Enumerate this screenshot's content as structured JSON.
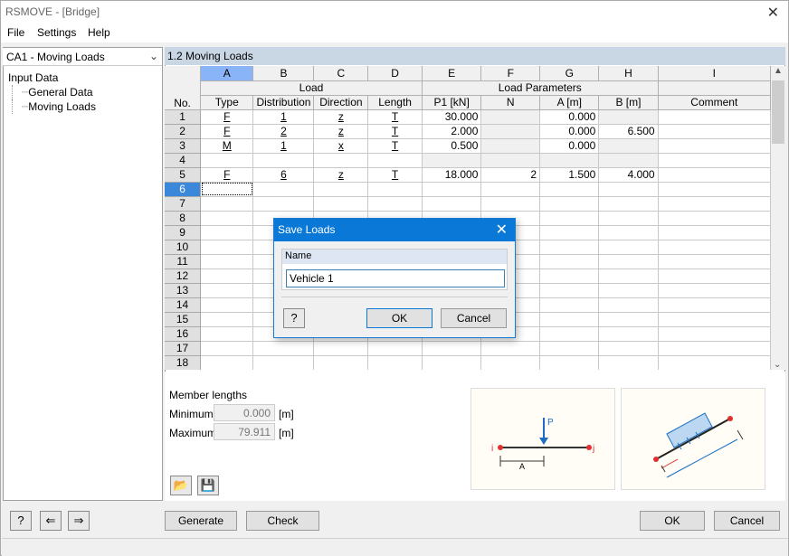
{
  "window": {
    "title": "RSMOVE - [Bridge]"
  },
  "menu": {
    "file": "File",
    "settings": "Settings",
    "help": "Help"
  },
  "case_selector": {
    "value": "CA1 - Moving Loads"
  },
  "tree": {
    "root": "Input Data",
    "items": [
      "General Data",
      "Moving Loads"
    ]
  },
  "panel": {
    "title": "1.2 Moving Loads"
  },
  "table": {
    "col_letters": [
      "A",
      "B",
      "C",
      "D",
      "E",
      "F",
      "G",
      "H",
      "I"
    ],
    "group_load": "Load",
    "group_params": "Load Parameters",
    "headers": [
      "No.",
      "Type",
      "Distribution",
      "Direction",
      "Length",
      "P1 [kN]",
      "N",
      "A [m]",
      "B [m]",
      "Comment"
    ],
    "rows": [
      {
        "no": "1",
        "type": "F",
        "dist": "1",
        "dir": "z",
        "len": "T",
        "p1": "30.000",
        "n": "",
        "a": "0.000",
        "b": "",
        "comment": ""
      },
      {
        "no": "2",
        "type": "F",
        "dist": "2",
        "dir": "z",
        "len": "T",
        "p1": "2.000",
        "n": "",
        "a": "0.000",
        "b": "6.500",
        "comment": ""
      },
      {
        "no": "3",
        "type": "M",
        "dist": "1",
        "dir": "x",
        "len": "T",
        "p1": "0.500",
        "n": "",
        "a": "0.000",
        "b": "",
        "comment": ""
      },
      {
        "no": "4",
        "type": "",
        "dist": "",
        "dir": "",
        "len": "",
        "p1": "",
        "n": "",
        "a": "",
        "b": "",
        "comment": ""
      },
      {
        "no": "5",
        "type": "F",
        "dist": "6",
        "dir": "z",
        "len": "T",
        "p1": "18.000",
        "n": "2",
        "a": "1.500",
        "b": "4.000",
        "comment": ""
      },
      {
        "no": "6",
        "type": "",
        "dist": "",
        "dir": "",
        "len": "",
        "p1": "",
        "n": "",
        "a": "",
        "b": "",
        "comment": ""
      },
      {
        "no": "7",
        "type": "",
        "dist": "",
        "dir": "",
        "len": "",
        "p1": "",
        "n": "",
        "a": "",
        "b": "",
        "comment": ""
      },
      {
        "no": "8",
        "type": "",
        "dist": "",
        "dir": "",
        "len": "",
        "p1": "",
        "n": "",
        "a": "",
        "b": "",
        "comment": ""
      },
      {
        "no": "9",
        "type": "",
        "dist": "",
        "dir": "",
        "len": "",
        "p1": "",
        "n": "",
        "a": "",
        "b": "",
        "comment": ""
      },
      {
        "no": "10",
        "type": "",
        "dist": "",
        "dir": "",
        "len": "",
        "p1": "",
        "n": "",
        "a": "",
        "b": "",
        "comment": ""
      },
      {
        "no": "11",
        "type": "",
        "dist": "",
        "dir": "",
        "len": "",
        "p1": "",
        "n": "",
        "a": "",
        "b": "",
        "comment": ""
      },
      {
        "no": "12",
        "type": "",
        "dist": "",
        "dir": "",
        "len": "",
        "p1": "",
        "n": "",
        "a": "",
        "b": "",
        "comment": ""
      },
      {
        "no": "13",
        "type": "",
        "dist": "",
        "dir": "",
        "len": "",
        "p1": "",
        "n": "",
        "a": "",
        "b": "",
        "comment": ""
      },
      {
        "no": "14",
        "type": "",
        "dist": "",
        "dir": "",
        "len": "",
        "p1": "",
        "n": "",
        "a": "",
        "b": "",
        "comment": ""
      },
      {
        "no": "15",
        "type": "",
        "dist": "",
        "dir": "",
        "len": "",
        "p1": "",
        "n": "",
        "a": "",
        "b": "",
        "comment": ""
      },
      {
        "no": "16",
        "type": "",
        "dist": "",
        "dir": "",
        "len": "",
        "p1": "",
        "n": "",
        "a": "",
        "b": "",
        "comment": ""
      },
      {
        "no": "17",
        "type": "",
        "dist": "",
        "dir": "",
        "len": "",
        "p1": "",
        "n": "",
        "a": "",
        "b": "",
        "comment": ""
      },
      {
        "no": "18",
        "type": "",
        "dist": "",
        "dir": "",
        "len": "",
        "p1": "",
        "n": "",
        "a": "",
        "b": "",
        "comment": ""
      }
    ]
  },
  "member_lengths": {
    "title": "Member lengths",
    "min_label": "Minimum:",
    "min_value": "0.000",
    "min_unit": "[m]",
    "max_label": "Maximum:",
    "max_value": "79.911",
    "max_unit": "[m]"
  },
  "diagram1": {
    "p": "P",
    "i": "i",
    "j": "j",
    "a": "A"
  },
  "buttons": {
    "generate": "Generate",
    "check": "Check",
    "ok": "OK",
    "cancel": "Cancel"
  },
  "dialog": {
    "title": "Save Loads",
    "group_label": "Name",
    "name_value": "Vehicle 1",
    "ok": "OK",
    "cancel": "Cancel"
  },
  "icons": [
    "help-icon",
    "import-icon",
    "export-icon",
    "open-folder-icon",
    "save-icon",
    "close-icon",
    "chevron-down-icon"
  ],
  "colors": {
    "accent": "#0a78d7",
    "selection": "#3b87d9",
    "header_blue": "#c9d6e3"
  }
}
